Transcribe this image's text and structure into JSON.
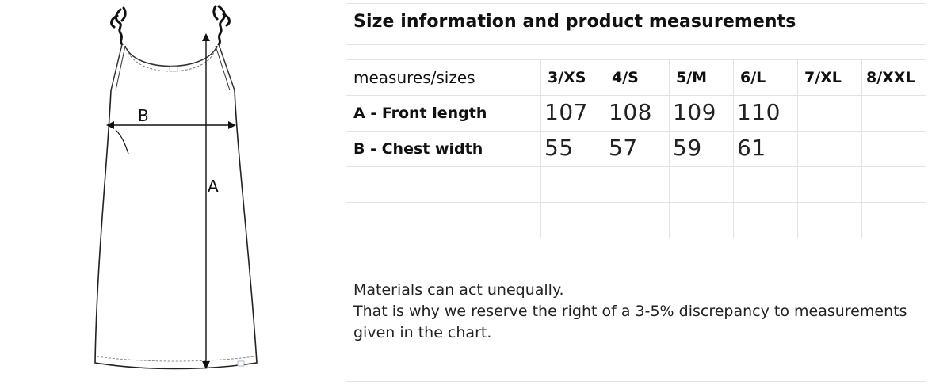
{
  "illustration": {
    "label_a": "A",
    "label_b": "B"
  },
  "sheet": {
    "title": "Size information and product measurements",
    "header_label": "measures/sizes",
    "sizes": [
      "3/XS",
      "4/S",
      "5/M",
      "6/L",
      "7/XL",
      "8/XXL"
    ],
    "rows": [
      {
        "label": "A - Front length",
        "values": [
          "107",
          "108",
          "109",
          "110",
          "",
          ""
        ]
      },
      {
        "label": "B - Chest width",
        "values": [
          "55",
          "57",
          "59",
          "61",
          "",
          ""
        ]
      }
    ],
    "note_line1": "Materials can act unequally.",
    "note_line2": "That is why we reserve the right of a 3-5% discrepancy to measurements given in the chart."
  }
}
